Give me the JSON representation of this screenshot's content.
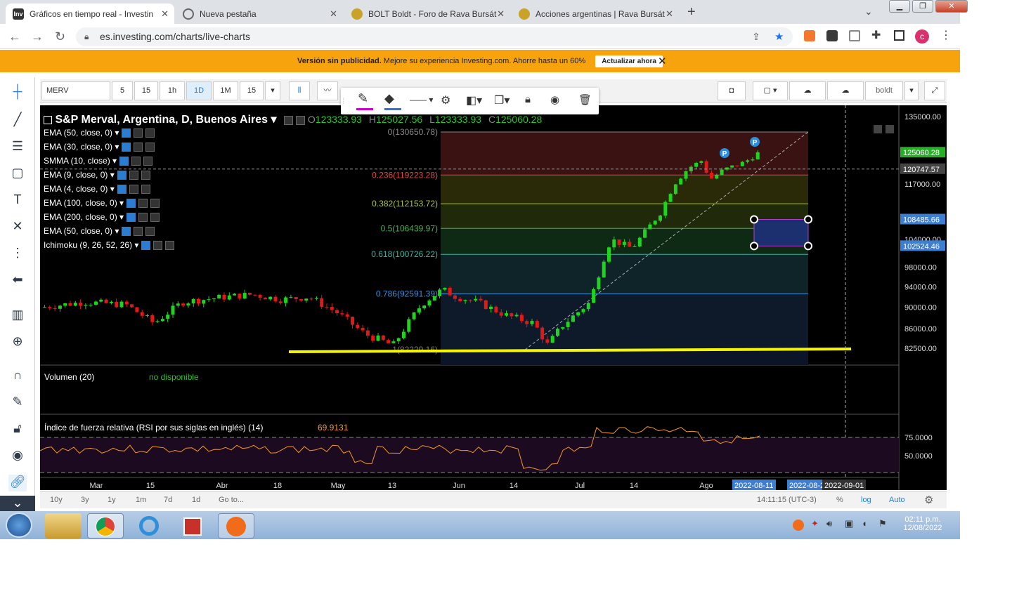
{
  "browser": {
    "tabs": [
      {
        "title": "Gráficos en tiempo real - Investin",
        "fav": "Inv",
        "color": "#333"
      },
      {
        "title": "Nueva pestaña",
        "fav": "",
        "color": "#666"
      },
      {
        "title": "BOLT Boldt - Foro de Rava Bursát",
        "fav": "",
        "color": "#c9a227"
      },
      {
        "title": "Acciones argentinas | Rava Bursát",
        "fav": "",
        "color": "#c9a227"
      }
    ],
    "new_tab": "+",
    "url": "es.investing.com/charts/live-charts",
    "profile_initial": "c"
  },
  "banner": {
    "bold": "Versión sin publicidad.",
    "text": "Mejore su experiencia Investing.com. Ahorre hasta un 60%",
    "button": "Actualizar ahora"
  },
  "toolbar": {
    "symbol": "MERV",
    "intervals": [
      "5",
      "15",
      "1h",
      "1D",
      "1M",
      "15"
    ],
    "user": "boldt"
  },
  "legend": {
    "title": "S&P Merval, Argentina, D, Buenos Aires",
    "o_label": "O",
    "o": "123333.93",
    "h_label": "H",
    "h": "125027.56",
    "l_label": "L",
    "l": "123333.93",
    "c_label": "C",
    "c": "125060.28",
    "indicators": [
      "EMA (50, close, 0)",
      "EMA (30, close, 0)",
      "SMMA (10, close)",
      "EMA (9, close, 0)",
      "EMA (4, close, 0)",
      "EMA (100, close, 0)",
      "EMA (200, close, 0)",
      "EMA (50, close, 0)",
      "Ichimoku (9, 26, 52, 26)"
    ]
  },
  "fib": [
    {
      "label": "0(130650.78)",
      "price": 130650.78,
      "color": "#888888"
    },
    {
      "label": "0.236(119223.28)",
      "price": 119223.28,
      "color": "#e04848"
    },
    {
      "label": "0.382(112153.72)",
      "price": 112153.72,
      "color": "#a8c83a"
    },
    {
      "label": "0.5(106439.97)",
      "price": 106439.97,
      "color": "#4caf50"
    },
    {
      "label": "0.618(100726.22)",
      "price": 100726.22,
      "color": "#3bb3a0"
    },
    {
      "label": "0.786(92591.39)",
      "price": 92591.39,
      "color": "#3a8fd8"
    },
    {
      "label": "1(82229.16)",
      "price": 82229.16,
      "color": "#777777"
    }
  ],
  "price_axis": [
    "135000.00",
    "117000.00",
    "104000.00",
    "98000.00",
    "94000.00",
    "90000.00",
    "86000.00",
    "82500.00"
  ],
  "price_badges": [
    {
      "text": "125060.28",
      "bg": "#27b027"
    },
    {
      "text": "120747.57",
      "bg": "#444444"
    },
    {
      "text": "108485.66",
      "bg": "#3c7ed2"
    },
    {
      "text": "102524.46",
      "bg": "#3c7ed2"
    }
  ],
  "markers": [
    "P",
    "P"
  ],
  "volume": {
    "label": "Volumen (20)",
    "status": "no disponible"
  },
  "rsi": {
    "label": "Índice de fuerza relativa (RSI por sus siglas en inglés) (14)",
    "value": "69.9131",
    "levels": [
      "75.0000",
      "50.0000"
    ]
  },
  "time_axis": [
    "Mar",
    "15",
    "Abr",
    "18",
    "May",
    "13",
    "Jun",
    "14",
    "Jul",
    "14",
    "Ago"
  ],
  "time_badges": [
    "2022-08-11",
    "2022-08-2",
    "2022-09-01"
  ],
  "bottom": {
    "ranges": [
      "10y",
      "3y",
      "1y",
      "1m",
      "7d",
      "1d",
      "Go to..."
    ],
    "clock": "14:11:15 (UTC-3)",
    "opts": [
      "%",
      "log",
      "Auto"
    ]
  },
  "taskbar": {
    "time": "02:11 p.m.",
    "date": "12/08/2022"
  }
}
